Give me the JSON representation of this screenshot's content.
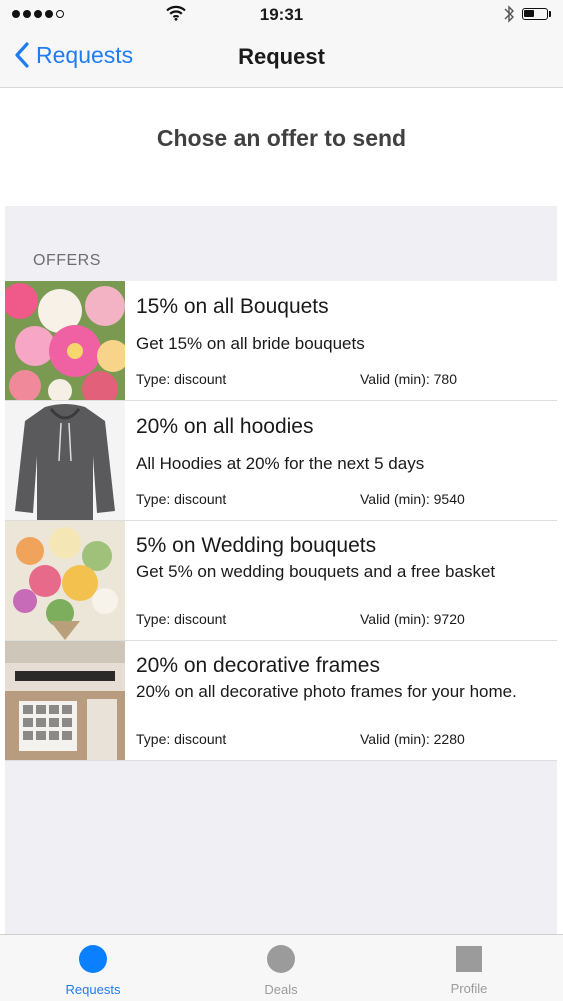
{
  "status_bar": {
    "time": "19:31",
    "signal_bars": 4,
    "battery_level": 0.45
  },
  "nav": {
    "back_label": "Requests",
    "title": "Request"
  },
  "heading": "Chose an offer to send",
  "offers_section_title": "OFFERS",
  "offers": [
    {
      "title": "15% on all Bouquets",
      "description": "Get 15% on all bride bouquets",
      "type": "Type: discount",
      "valid": "Valid (min): 780",
      "image": "flower-bouquet-image"
    },
    {
      "title": "20% on all hoodies",
      "description": "All Hoodies at 20% for the next 5 days",
      "type": "Type: discount",
      "valid": "Valid (min): 9540",
      "image": "grey-hoodie-image"
    },
    {
      "title": "5% on Wedding bouquets",
      "description": "Get 5% on wedding bouquets and a free basket",
      "type": "Type: discount",
      "valid": "Valid (min): 9720",
      "image": "wedding-bouquet-image"
    },
    {
      "title": "20% on decorative frames",
      "description": "20% on all decorative photo frames for your home.",
      "type": "Type: discount",
      "valid": "Valid (min): 2280",
      "image": "photo-frames-image"
    }
  ],
  "tabs": [
    {
      "label": "Requests",
      "active": true,
      "icon": "circle-icon"
    },
    {
      "label": "Deals",
      "active": false,
      "icon": "circle-icon"
    },
    {
      "label": "Profile",
      "active": false,
      "icon": "square-icon"
    }
  ],
  "colors": {
    "accent": "#1f7cf2",
    "tab_active": "#0a80ff",
    "tab_inactive": "#9b9b9b",
    "background_grey": "#efeff4"
  }
}
